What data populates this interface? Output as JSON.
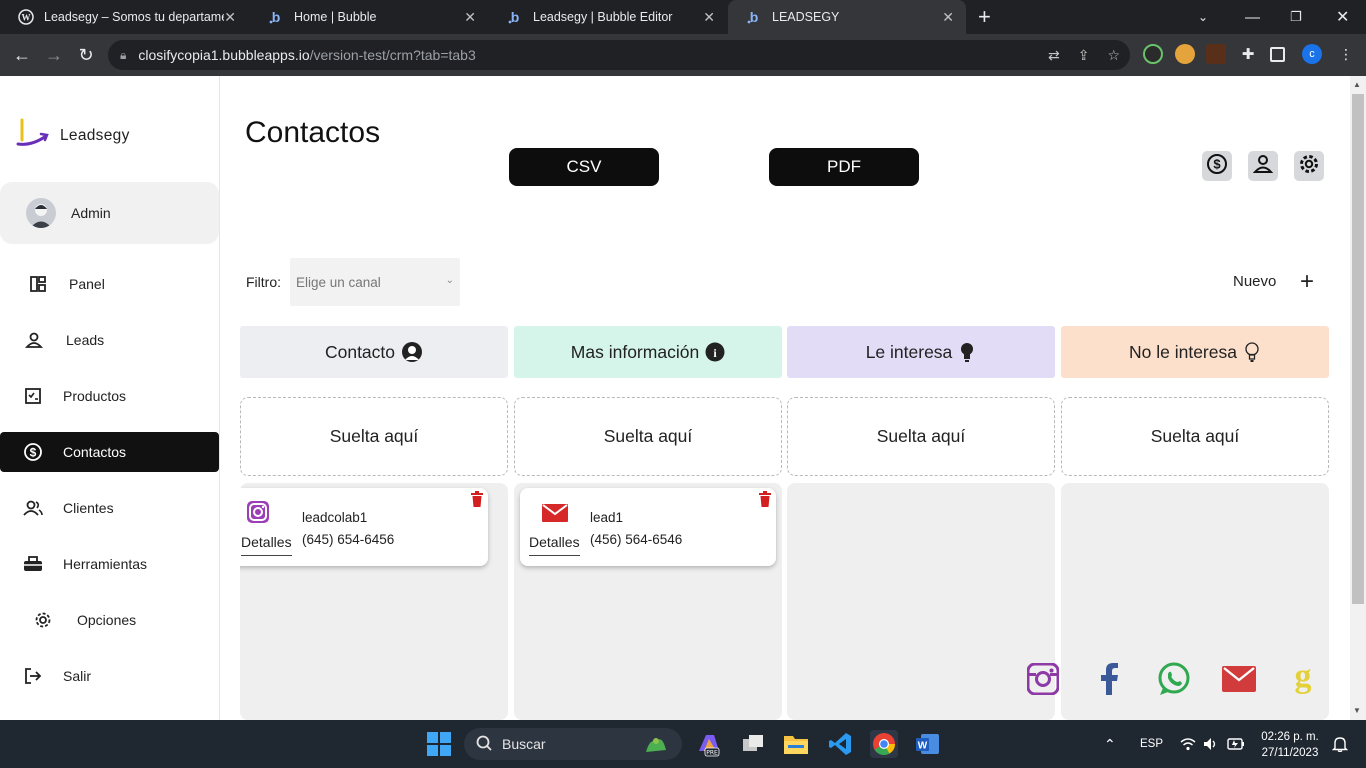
{
  "browser": {
    "tabs": [
      {
        "label": "Leadsegy – Somos tu departame",
        "icon": "wordpress-icon",
        "active": false
      },
      {
        "label": "Home | Bubble",
        "icon": "bubble-icon",
        "active": false
      },
      {
        "label": "Leadsegy | Bubble Editor",
        "icon": "bubble-icon",
        "active": false
      },
      {
        "label": "LEADSEGY",
        "icon": "bubble-icon",
        "active": true
      }
    ],
    "url_host": "closifycopia1.bubbleapps.io",
    "url_path": "/version-test/crm?tab=tab3",
    "profile_initial": "c"
  },
  "sidebar": {
    "brand": "Leadsegy",
    "user": "Admin",
    "items": [
      {
        "label": "Panel",
        "icon": "panel-icon"
      },
      {
        "label": "Leads",
        "icon": "user-icon"
      },
      {
        "label": "Productos",
        "icon": "checklist-icon"
      },
      {
        "label": "Contactos",
        "icon": "dollar-icon",
        "active": true
      },
      {
        "label": "Clientes",
        "icon": "users-icon"
      },
      {
        "label": "Herramientas",
        "icon": "toolbox-icon"
      },
      {
        "label": "Opciones",
        "icon": "gear-icon"
      },
      {
        "label": "Salir",
        "icon": "logout-icon"
      }
    ]
  },
  "main": {
    "title": "Contactos",
    "csv_label": "CSV",
    "pdf_label": "PDF",
    "filter_label": "Filtro:",
    "filter_placeholder": "Elige un canal",
    "new_label": "Nuevo",
    "new_symbol": "+",
    "columns": [
      {
        "title": "Contacto",
        "color": "#eceef2",
        "drop": "Suelta aquí"
      },
      {
        "title": "Mas información",
        "color": "#d5f5ea",
        "drop": "Suelta aquí"
      },
      {
        "title": "Le interesa",
        "color": "#e3dcf7",
        "drop": "Suelta aquí"
      },
      {
        "title": "No le interesa",
        "color": "#fde0cc",
        "drop": "Suelta aquí"
      }
    ],
    "cards": [
      {
        "name": "leadcolab1",
        "phone": "(645) 654-6456",
        "details": "Detalles",
        "channel": "instagram-icon"
      },
      {
        "name": "lead1",
        "phone": "(456) 564-6546",
        "details": "Detalles",
        "channel": "email-icon"
      }
    ],
    "social": [
      "instagram-icon",
      "facebook-icon",
      "whatsapp-icon",
      "email-icon",
      "google-icon"
    ]
  },
  "taskbar": {
    "search_label": "Buscar",
    "language": "ESP",
    "time": "02:26 p. m.",
    "date": "27/11/2023"
  }
}
